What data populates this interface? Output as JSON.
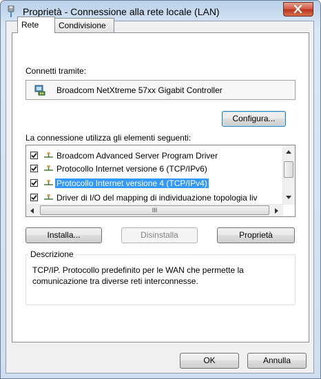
{
  "window": {
    "title": "Proprietà - Connessione alla rete locale (LAN)"
  },
  "tabs": [
    {
      "label": "Rete",
      "active": true
    },
    {
      "label": "Condivisione",
      "active": false
    }
  ],
  "connect_via": {
    "label": "Connetti tramite:",
    "device": "Broadcom NetXtreme 57xx Gigabit Controller",
    "configure_label": "Configura..."
  },
  "items": {
    "label": "La connessione utilizza gli elementi seguenti:",
    "rows": [
      {
        "label": "Broadcom Advanced Server Program Driver",
        "checked": true,
        "selected": false
      },
      {
        "label": "Protocollo Internet versione 6 (TCP/IPv6)",
        "checked": true,
        "selected": false
      },
      {
        "label": "Protocollo Internet versione 4 (TCP/IPv4)",
        "checked": true,
        "selected": true
      },
      {
        "label": "Driver di I/O del mapping di individuazione topologia liv",
        "checked": true,
        "selected": false
      }
    ],
    "scroll_glyph": "III"
  },
  "actions": {
    "install_label": "Installa...",
    "uninstall_label": "Disinstalla",
    "properties_label": "Proprietà"
  },
  "description": {
    "title": "Descrizione",
    "text": "TCP/IP. Protocollo predefinito per le WAN che permette la comunicazione tra diverse reti interconnesse."
  },
  "footer": {
    "ok_label": "OK",
    "cancel_label": "Annulla"
  },
  "colors": {
    "selection": "#3399ff",
    "close_button": "#c94a33"
  }
}
